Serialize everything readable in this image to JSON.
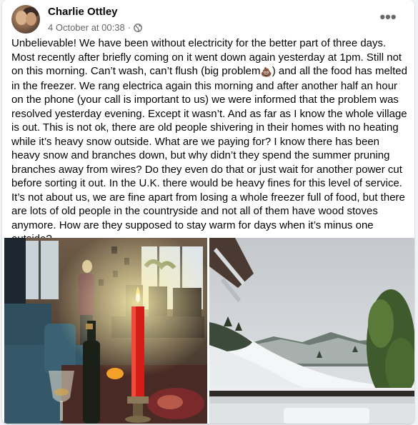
{
  "post": {
    "author": "Charlie Ottley",
    "date": "4 October at 00:38",
    "separator": "·",
    "audience_icon": "globe-icon",
    "more_label": "•••",
    "text_before_emoji": "Unbelievable! We have been without electricity for the better part of three days. Most recently after briefly coming on it went down again yesterday at 1pm. Still not on this morning. Can’t wash, can’t flush (big problem",
    "emoji": "💩",
    "text_after_emoji": ") and all the food has melted in the freezer. We rang electrica again this morning and after another half an hour on the phone (your call is important to us) we were informed that the problem was resolved yesterday evening. Except it wasn’t. And as far as I know the whole village is out. This is not ok, there are old people shivering in their homes with no heating while it’s heavy snow outside. What are we paying for? I know there has been heavy snow and branches down, but why didn’t they spend the summer pruning branches away from wires? Do they even do that or just wait for another power cut before sorting it out. In the U.K. there would be heavy fines for this level of service. It’s not about us, we are fine apart from losing a whole freezer full of food, but there are lots of old people in the countryside and not all of them have wood stoves anymore. How are they supposed to stay warm for days when it’s minus one outside?"
  },
  "photos": [
    {
      "name": "candlelit-living-room-photo"
    },
    {
      "name": "snowy-mountain-view-photo"
    }
  ],
  "colors": {
    "background": "#f0f2f5",
    "card": "#ffffff",
    "text": "#050505",
    "secondary_text": "#65676b"
  }
}
